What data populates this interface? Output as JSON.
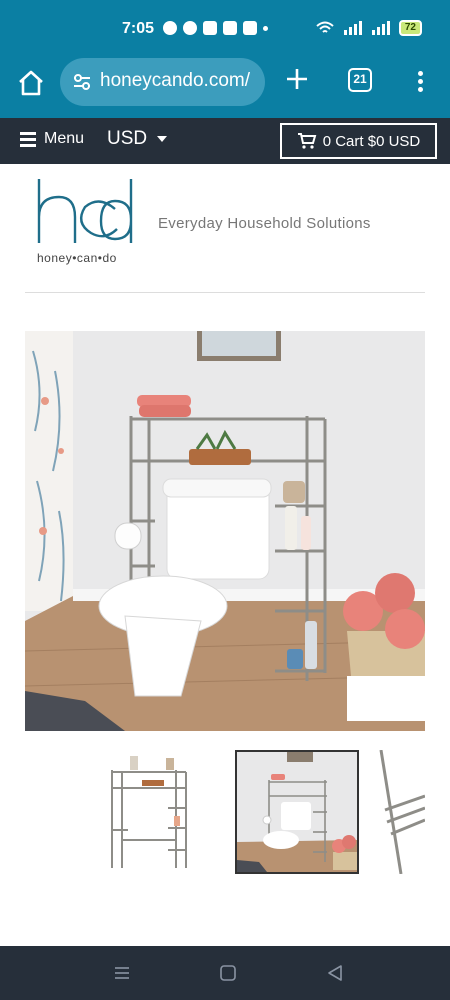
{
  "status_bar": {
    "time": "7:05",
    "battery": "72"
  },
  "browser": {
    "url": "honeycando.com/",
    "tab_count": "21"
  },
  "site_nav": {
    "menu_label": "Menu",
    "currency": "USD",
    "cart_label": "0 Cart $0 USD"
  },
  "brand": {
    "logo_text": "honey•can•do",
    "tagline": "Everyday Household Solutions"
  },
  "product": {
    "thumbnail_count": 3,
    "active_thumbnail": 2
  },
  "colors": {
    "browser_teal": "#0b7fa3",
    "nav_dark": "#262f3a",
    "towel_pink": "#e8837a"
  },
  "icons": [
    "home-icon",
    "tune-icon",
    "plus-icon",
    "tabs-icon",
    "kebab-icon",
    "hamburger-icon",
    "caret-down-icon",
    "cart-icon",
    "recents-icon",
    "home-nav-icon",
    "back-icon"
  ]
}
